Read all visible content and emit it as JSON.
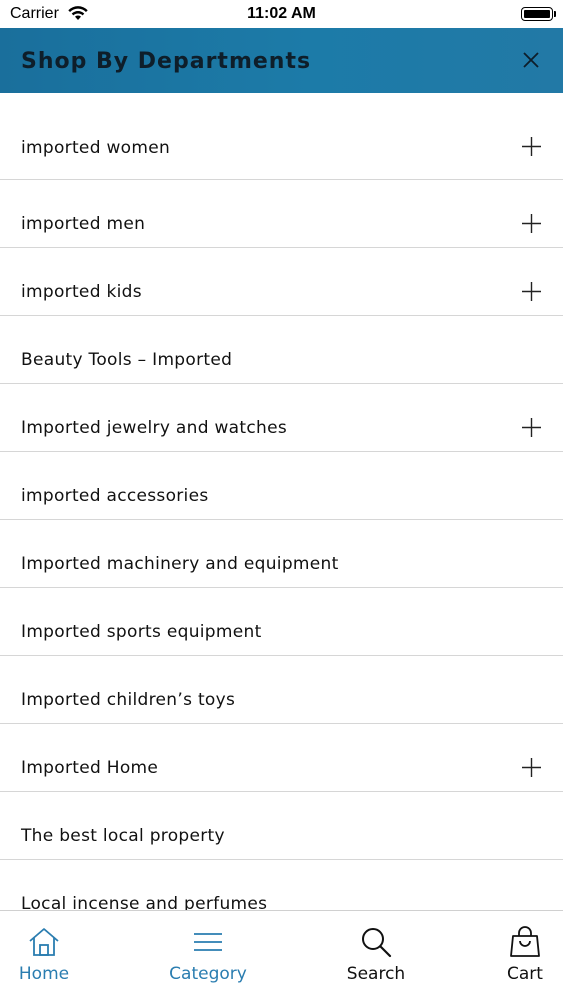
{
  "status_bar": {
    "carrier": "Carrier",
    "time": "11:02 AM"
  },
  "header": {
    "title": "Shop By Departments"
  },
  "colors": {
    "header_accent": "#1c7ba8",
    "active_tab": "#2a7db0",
    "text": "#111111",
    "divider": "#d6d6d6"
  },
  "departments": [
    {
      "label": "imported women",
      "expandable": true
    },
    {
      "label": "imported men",
      "expandable": true
    },
    {
      "label": "imported kids",
      "expandable": true
    },
    {
      "label": "Beauty Tools – Imported",
      "expandable": false
    },
    {
      "label": "Imported jewelry and watches",
      "expandable": true
    },
    {
      "label": "imported accessories",
      "expandable": false
    },
    {
      "label": "Imported machinery and equipment",
      "expandable": false
    },
    {
      "label": "Imported sports equipment",
      "expandable": false
    },
    {
      "label": "Imported children’s toys",
      "expandable": false
    },
    {
      "label": "Imported Home",
      "expandable": true
    },
    {
      "label": "The best local property",
      "expandable": false
    },
    {
      "label": "Local incense and perfumes",
      "expandable": false
    }
  ],
  "tabbar": {
    "home": {
      "label": "Home",
      "icon": "home-icon"
    },
    "category": {
      "label": "Category",
      "icon": "menu-icon"
    },
    "search": {
      "label": "Search",
      "icon": "search-icon"
    },
    "cart": {
      "label": "Cart",
      "icon": "shopping-bag-icon"
    }
  }
}
